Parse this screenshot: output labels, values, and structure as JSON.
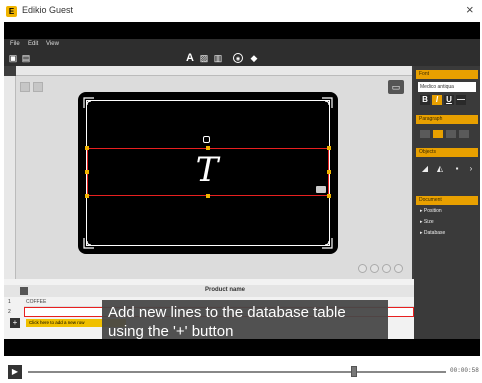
{
  "window": {
    "title": "Edikio Guest",
    "close_glyph": "×",
    "app_icon": "E"
  },
  "menu": [
    "File",
    "Edit",
    "View"
  ],
  "toolbar": {
    "left_icons": [
      "save-icon",
      "print-icon"
    ],
    "center_icons": [
      "text-icon",
      "image-icon",
      "barcode-icon",
      "qr-icon",
      "layers-icon"
    ],
    "text_glyph": "A"
  },
  "canvas": {
    "lock_glyph": "▭",
    "text_placeholder": "T"
  },
  "right_panel": {
    "sections": [
      "Font",
      "Paragraph",
      "Objects",
      "Document"
    ],
    "font_name": "Medico antiqua",
    "format_buttons": [
      "B",
      "I",
      "U",
      "—"
    ],
    "document_items": [
      "▸ Position",
      "▸ Size",
      "▸ Database"
    ]
  },
  "data_panel": {
    "column_header": "Product name",
    "rows": [
      {
        "num": "1",
        "value": "COFFEE"
      },
      {
        "num": "2",
        "value": ""
      }
    ],
    "add_glyph": "+",
    "hint": "Click here to add a new row"
  },
  "caption": "Add new lines to the database table using the '+' button",
  "player": {
    "play_glyph": "▶",
    "time": "00:00:58",
    "progress": 0.78
  },
  "colors": {
    "accent": "#e8a000",
    "selection": "#e82020",
    "chrome": "#3e3e3e"
  }
}
